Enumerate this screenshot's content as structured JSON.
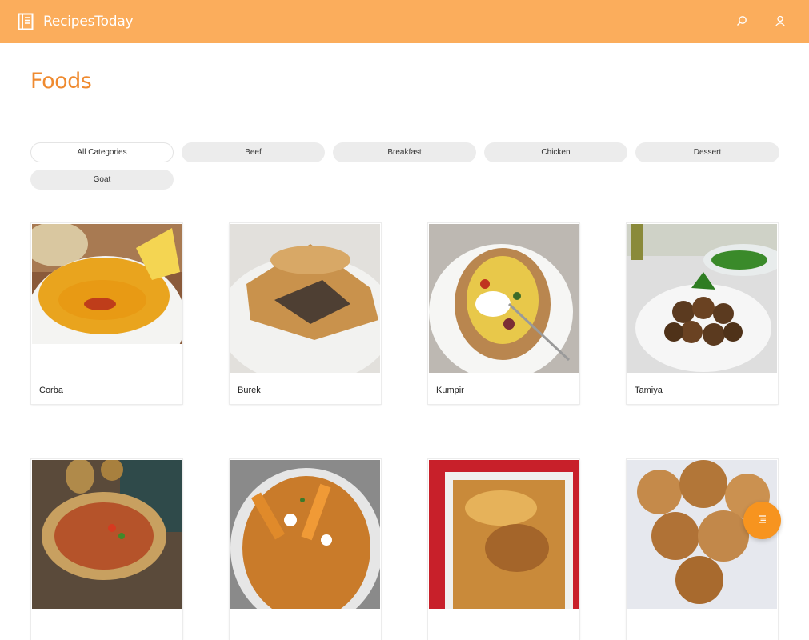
{
  "header": {
    "brand_name": "RecipesToday",
    "brand_icon": "book-icon",
    "search_icon": "search-icon",
    "user_icon": "user-icon",
    "color": "#fbad5c"
  },
  "page": {
    "title": "Foods",
    "title_color": "#ef8a2f"
  },
  "categories": [
    {
      "label": "All Categories",
      "active": true
    },
    {
      "label": "Beef",
      "active": false
    },
    {
      "label": "Breakfast",
      "active": false
    },
    {
      "label": "Chicken",
      "active": false
    },
    {
      "label": "Dessert",
      "active": false
    },
    {
      "label": "Goat",
      "active": false
    }
  ],
  "foods": [
    {
      "name": "Corba"
    },
    {
      "name": "Burek"
    },
    {
      "name": "Kumpir"
    },
    {
      "name": "Tamiya"
    },
    {
      "name": ""
    },
    {
      "name": ""
    },
    {
      "name": ""
    },
    {
      "name": ""
    }
  ],
  "fab": {
    "icon": "list-icon",
    "color": "#f7941f"
  }
}
